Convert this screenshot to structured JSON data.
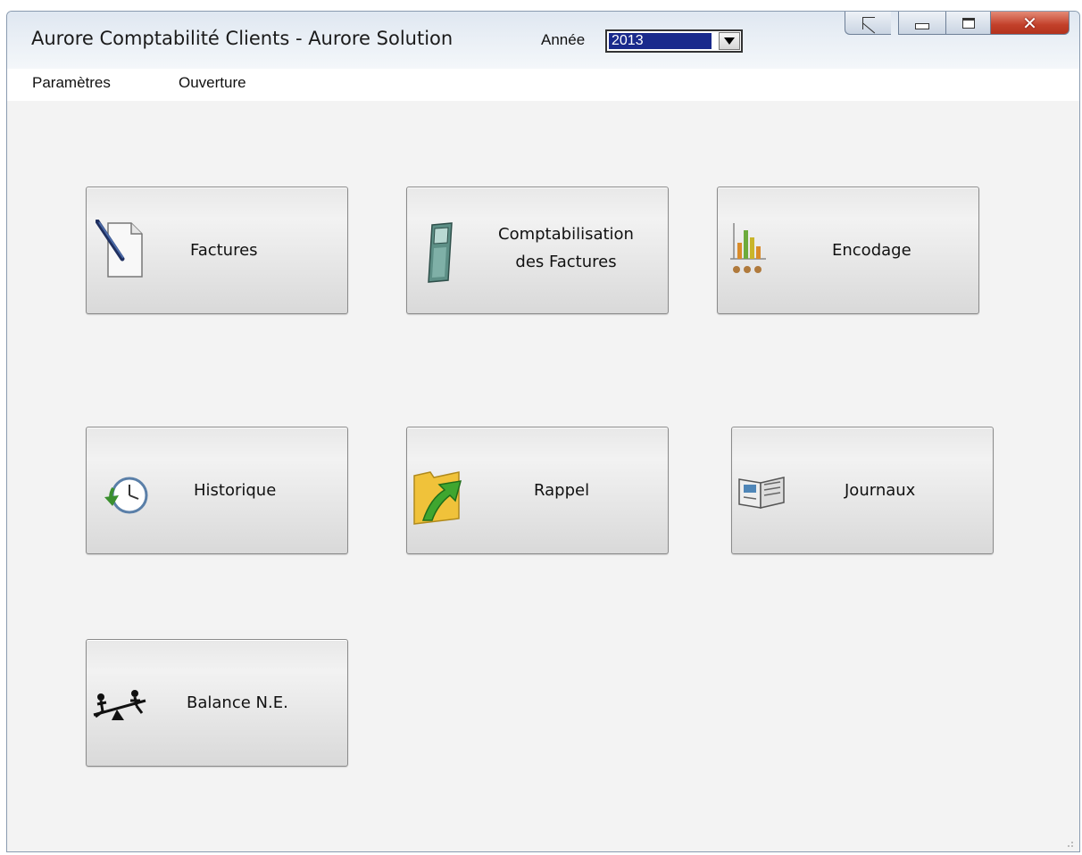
{
  "window": {
    "title": "Aurore Comptabilité Clients - Aurore Solution",
    "year_label": "Année",
    "year_value": "2013"
  },
  "menu": [
    {
      "label": "Paramètres"
    },
    {
      "label": "Ouverture"
    }
  ],
  "tiles": {
    "factures": {
      "label": "Factures",
      "icon": "pen-paper-icon"
    },
    "comptabilisation": {
      "line1": "Comptabilisation",
      "line2": "des Factures",
      "icon": "calculator-icon"
    },
    "encodage": {
      "label": "Encodage",
      "icon": "abacus-chart-icon"
    },
    "historique": {
      "label": "Historique",
      "icon": "clock-history-icon"
    },
    "rappel": {
      "label": "Rappel",
      "icon": "folder-arrow-icon"
    },
    "journaux": {
      "label": "Journaux",
      "icon": "open-book-icon"
    },
    "balance": {
      "label": "Balance N.E.",
      "icon": "seesaw-icon"
    }
  },
  "colors": {
    "title_bar": "#e3eaf3",
    "close_button": "#c2402a",
    "year_highlight": "#1a2a8c",
    "background": "#f3f3f3"
  }
}
